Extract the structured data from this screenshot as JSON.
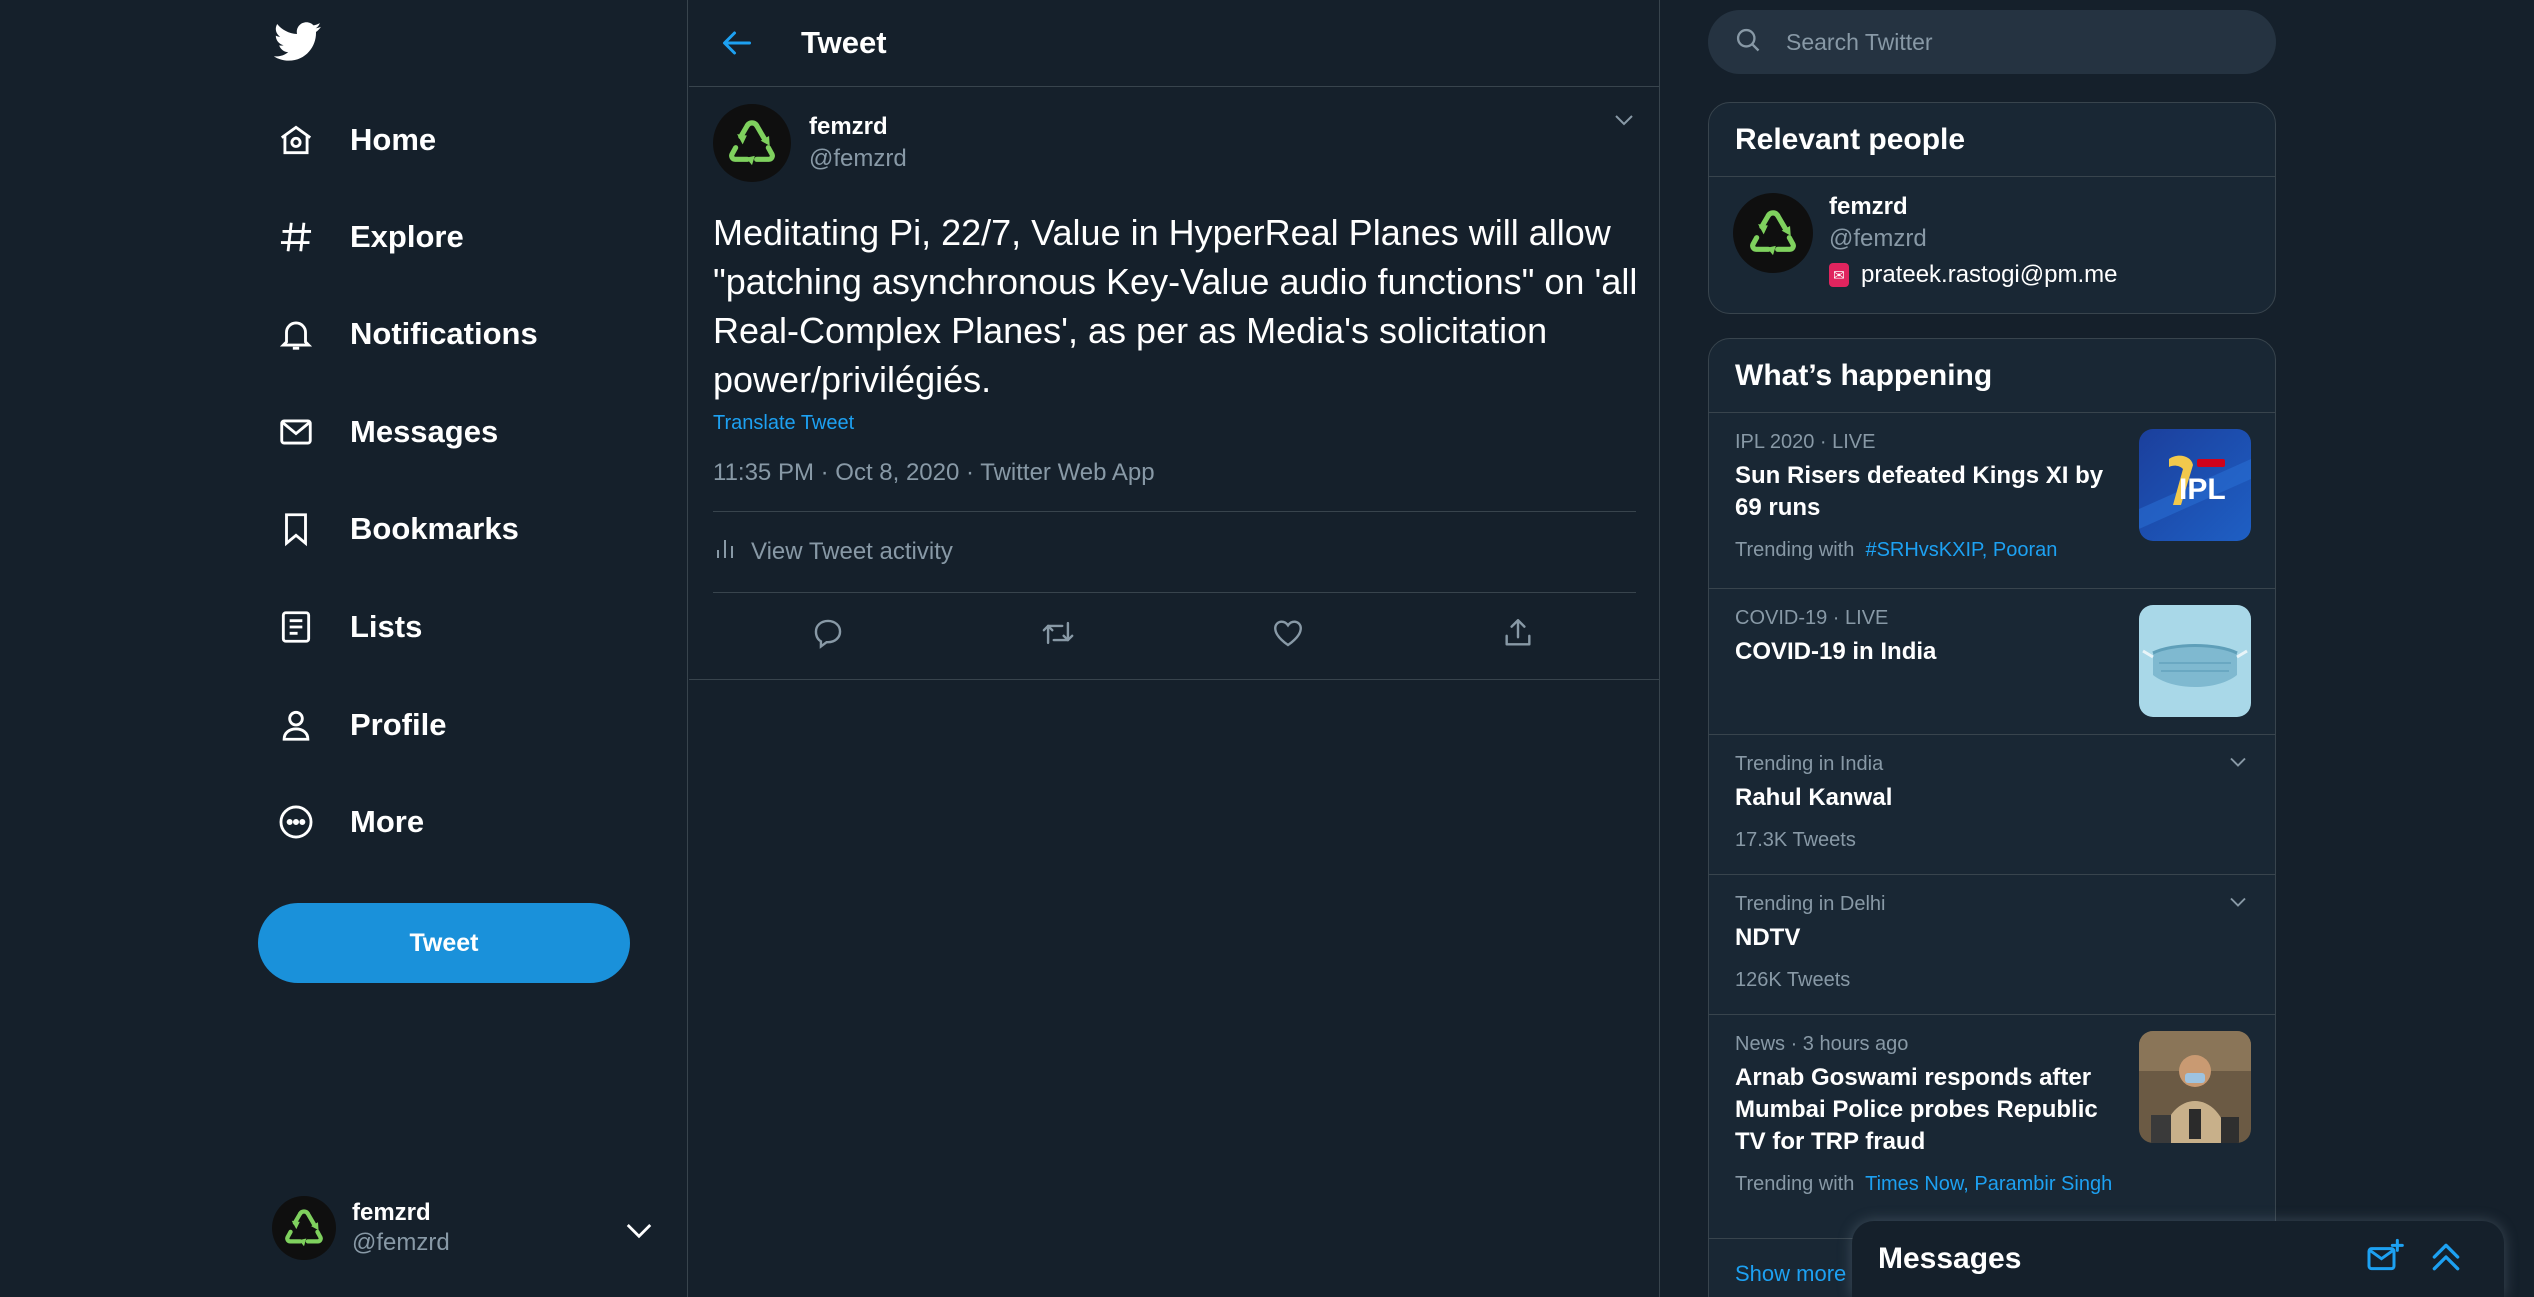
{
  "colors": {
    "background": "#15202b",
    "accent": "#1da1f2",
    "tweet_button": "#1a91da",
    "muted_text": "#8899a6",
    "border": "#38444d"
  },
  "nav": {
    "logo_icon": "twitter-bird-icon",
    "items": [
      {
        "label": "Home",
        "icon": "home-icon"
      },
      {
        "label": "Explore",
        "icon": "hashtag-icon"
      },
      {
        "label": "Notifications",
        "icon": "bell-icon"
      },
      {
        "label": "Messages",
        "icon": "envelope-icon"
      },
      {
        "label": "Bookmarks",
        "icon": "bookmark-icon"
      },
      {
        "label": "Lists",
        "icon": "list-icon"
      },
      {
        "label": "Profile",
        "icon": "person-icon"
      },
      {
        "label": "More",
        "icon": "more-circle-icon"
      }
    ],
    "tweet_button": "Tweet",
    "account": {
      "name": "femzrd",
      "handle": "@femzrd"
    }
  },
  "center": {
    "header_title": "Tweet",
    "tweet": {
      "author_name": "femzrd",
      "author_handle": "@femzrd",
      "text": "Meditating Pi, 22/7, Value in HyperReal Planes will allow \"patching asynchronous Key-Value audio functions\" on 'all Real-Complex Planes', as per as Media's solicitation power/privilégiés.",
      "translate_label": "Translate Tweet",
      "meta": "11:35 PM · Oct 8, 2020 · Twitter Web App",
      "activity_label": "View Tweet activity"
    }
  },
  "right": {
    "search_placeholder": "Search Twitter",
    "relevant": {
      "title": "Relevant people",
      "person": {
        "name": "femzrd",
        "handle": "@femzrd",
        "email": "prateek.rastogi@pm.me"
      }
    },
    "happening": {
      "title": "What’s happening",
      "trends": [
        {
          "context": "IPL 2020 · LIVE",
          "title": "Sun Risers defeated Kings XI by 69 runs",
          "trending_with_label": "Trending with",
          "trending_with": "#SRHvsKXIP, Pooran",
          "thumb": "ipl-logo"
        },
        {
          "context": "COVID-19 · LIVE",
          "title": "COVID-19 in India",
          "thumb": "face-mask"
        },
        {
          "context": "Trending in India",
          "title": "Rahul Kanwal",
          "count": "17.3K Tweets"
        },
        {
          "context": "Trending in Delhi",
          "title": "NDTV",
          "count": "126K Tweets"
        },
        {
          "context": "News · 3 hours ago",
          "title": "Arnab Goswami responds after Mumbai Police probes Republic TV for TRP fraud",
          "trending_with_label": "Trending with",
          "trending_with": "Times Now, Parambir Singh",
          "thumb": "police-officer"
        }
      ],
      "show_more": "Show more"
    }
  },
  "messages_dock": {
    "title": "Messages"
  }
}
